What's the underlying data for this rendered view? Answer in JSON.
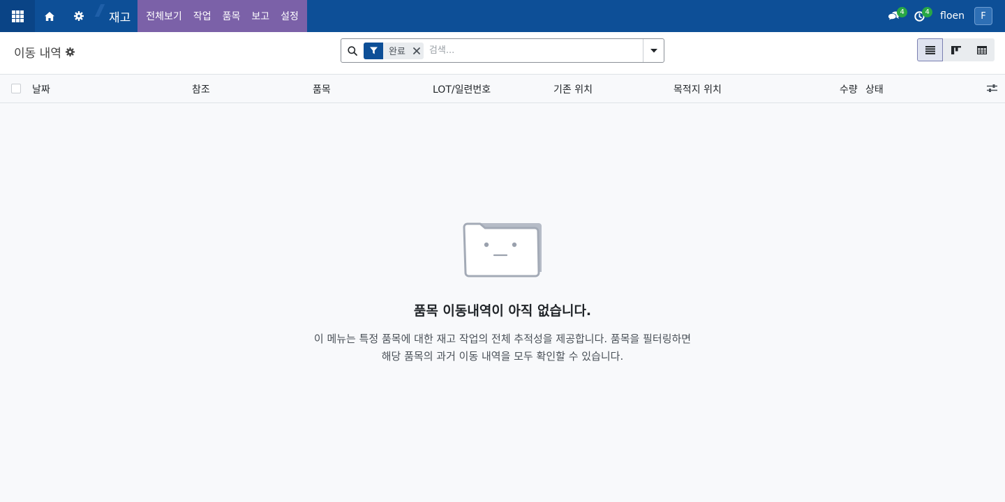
{
  "navbar": {
    "app_title": "재고",
    "menu": [
      {
        "label": "전체보기"
      },
      {
        "label": "작업"
      },
      {
        "label": "품목"
      },
      {
        "label": "보고"
      },
      {
        "label": "설정"
      }
    ],
    "messages_count": "4",
    "activities_count": "4",
    "user_name": "floen",
    "avatar_initial": "F"
  },
  "control_panel": {
    "breadcrumb": "이동 내역",
    "search": {
      "facet_label": "완료",
      "placeholder": "검색..."
    }
  },
  "list": {
    "columns": [
      {
        "label": "날짜"
      },
      {
        "label": "참조"
      },
      {
        "label": "품목"
      },
      {
        "label": "LOT/일련번호"
      },
      {
        "label": "기존 위치"
      },
      {
        "label": "목적지 위치"
      },
      {
        "label": "수량"
      },
      {
        "label": "상태"
      }
    ]
  },
  "empty_state": {
    "title": "품목 이동내역이 아직 없습니다.",
    "line1": "이 메뉴는 특정 품목에 대한 재고 작업의 전체 추적성을 제공합니다. 품목을 필터링하면",
    "line2": "해당 품목의 과거 이동 내역을 모두 확인할 수 있습니다."
  },
  "colors": {
    "navbar": "#0d4f97",
    "menu_highlight": "#7b61a8",
    "badge": "#28a745"
  }
}
